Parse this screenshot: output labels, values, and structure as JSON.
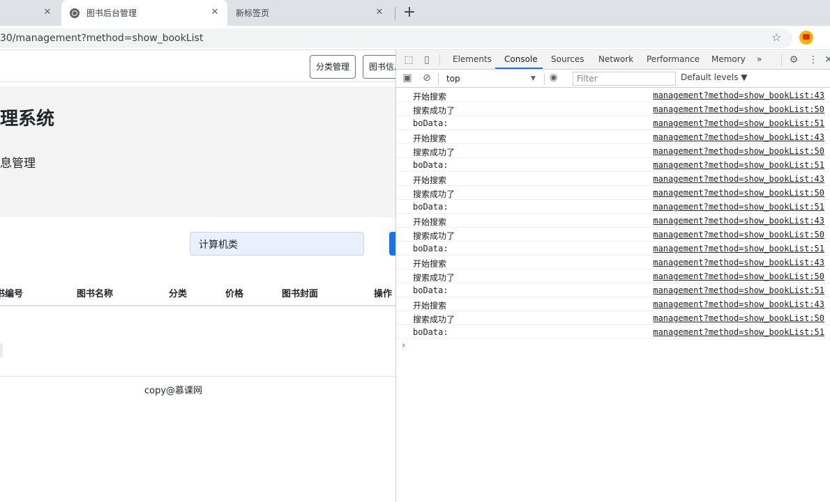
{
  "browser": {
    "tabs": [
      {
        "label": "",
        "close": "✕"
      },
      {
        "label": "图书后台管理",
        "close": "✕"
      },
      {
        "label": "新标签页",
        "close": "✕"
      }
    ],
    "new_tab": "+",
    "url": "30/management?method=show_bookList"
  },
  "page": {
    "nav_buttons": [
      "分类管理",
      "图书信息"
    ],
    "jumbotron": {
      "title": "理系统",
      "subtitle": "息管理"
    },
    "search": {
      "value": "计算机类"
    },
    "table_headers": [
      "书编号",
      "图书名称",
      "分类",
      "价格",
      "图书封面",
      "操作"
    ],
    "footer": "copy@慕课网"
  },
  "devtools": {
    "tabs": [
      "Elements",
      "Console",
      "Sources",
      "Network",
      "Performance",
      "Memory"
    ],
    "active_tab": "Console",
    "more": "»",
    "context": "top",
    "filter_placeholder": "Filter",
    "levels": "Default levels ▼",
    "logs": [
      {
        "msg": "开始搜索",
        "src": "management?method=show_bookList:43"
      },
      {
        "msg": "搜索成功了",
        "src": "management?method=show_bookList:50"
      },
      {
        "msg": "boData:",
        "src": "management?method=show_bookList:51"
      },
      {
        "msg": "开始搜索",
        "src": "management?method=show_bookList:43"
      },
      {
        "msg": "搜索成功了",
        "src": "management?method=show_bookList:50"
      },
      {
        "msg": "boData:",
        "src": "management?method=show_bookList:51"
      },
      {
        "msg": "开始搜索",
        "src": "management?method=show_bookList:43"
      },
      {
        "msg": "搜索成功了",
        "src": "management?method=show_bookList:50"
      },
      {
        "msg": "boData:",
        "src": "management?method=show_bookList:51"
      },
      {
        "msg": "开始搜索",
        "src": "management?method=show_bookList:43"
      },
      {
        "msg": "搜索成功了",
        "src": "management?method=show_bookList:50"
      },
      {
        "msg": "boData:",
        "src": "management?method=show_bookList:51"
      },
      {
        "msg": "开始搜索",
        "src": "management?method=show_bookList:43"
      },
      {
        "msg": "搜索成功了",
        "src": "management?method=show_bookList:50"
      },
      {
        "msg": "boData:",
        "src": "management?method=show_bookList:51"
      },
      {
        "msg": "开始搜索",
        "src": "management?method=show_bookList:43"
      },
      {
        "msg": "搜索成功了",
        "src": "management?method=show_bookList:50"
      },
      {
        "msg": "boData:",
        "src": "management?method=show_bookList:51"
      }
    ],
    "prompt": "›"
  }
}
